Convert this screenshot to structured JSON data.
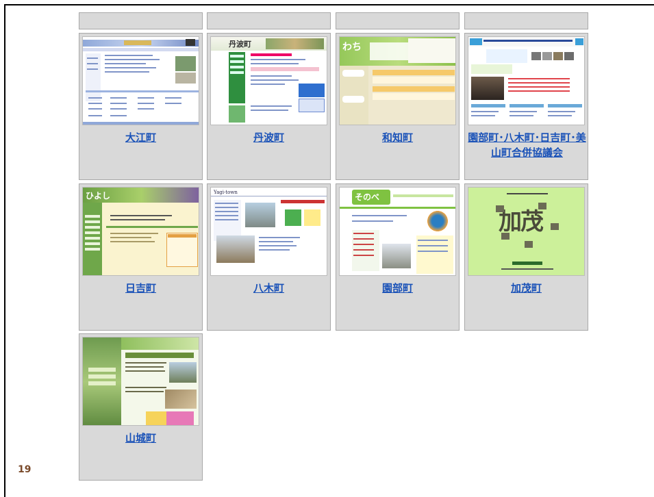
{
  "slide_number": "19",
  "cards": [
    {
      "label": "大江町",
      "site": "ooe"
    },
    {
      "label": "丹波町",
      "site": "tanba"
    },
    {
      "label": "和知町",
      "site": "wachi"
    },
    {
      "label": "園部町･八木町･日吉町･美山町合併協議会",
      "site": "gappei"
    },
    {
      "label": "日吉町",
      "site": "hiyoshi"
    },
    {
      "label": "八木町",
      "site": "yagi"
    },
    {
      "label": "園部町",
      "site": "sonobe"
    },
    {
      "label": "加茂町",
      "site": "kamo"
    },
    {
      "label": "山城町",
      "site": "yamashiro"
    }
  ],
  "thumb_text": {
    "tanba_logo": "丹波町",
    "kamo_logo": "加茂",
    "sonobe_logo": "そのべ",
    "hiyoshi_logo": "ひよし",
    "wachi_logo": "わち",
    "yagi_logo": "Yagi-town"
  }
}
